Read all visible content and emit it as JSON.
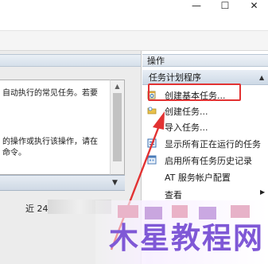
{
  "window": {
    "minimize_glyph": "—",
    "maximize_glyph": "☐",
    "close_glyph": "✕"
  },
  "middle_pane": {
    "summary_line1": "自动执行的常见任务。若要",
    "summary_line3": "的操作或执行该操作，请在",
    "summary_line4": "命令。",
    "recent_label": "近 24 小"
  },
  "actions_pane": {
    "header": "操作",
    "group_title": "任务计划程序",
    "items": [
      {
        "label": "创建基本任务...",
        "icon": "calendar-wand-icon"
      },
      {
        "label": "创建任务...",
        "icon": "folder-clock-icon"
      },
      {
        "label": "导入任务...",
        "icon": "none"
      },
      {
        "label": "显示所有正在运行的任务",
        "icon": "running-tasks-icon"
      },
      {
        "label": "启用所有任务历史记录",
        "icon": "history-icon"
      },
      {
        "label": "AT 服务帐户配置",
        "icon": "none"
      },
      {
        "label": "查看",
        "icon": "none"
      }
    ]
  },
  "annotation": {
    "highlight_color": "#e23232"
  },
  "watermark": {
    "text": "木星教程网"
  },
  "colors": {
    "pane_header": "#dbe3ec",
    "watermark": "#7f58d6"
  }
}
